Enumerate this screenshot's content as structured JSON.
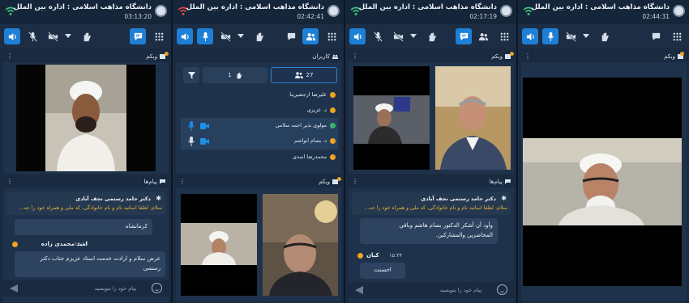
{
  "app": {
    "title": "دانشگاه مذاهب اسلامی : اداره بین الملل",
    "times": [
      "03:13:20",
      "02:42:41",
      "02:17:19",
      "02:44:31"
    ]
  },
  "colors": {
    "accent": "#1d7fd6",
    "orange": "#f0a321",
    "green": "#3ab36d",
    "pinned_text": "#f1b738"
  },
  "panels": {
    "webcam": "وبکم",
    "messages": "پیام‌ها",
    "users": "کاربران"
  },
  "users_panel": {
    "count_all": "27",
    "count_raised": "1",
    "list": [
      {
        "name": "علیرضا ارجشیرینا",
        "status": "orange"
      },
      {
        "name": "د. عزیزی",
        "status": "orange"
      },
      {
        "name": "مولوی نذیر احمد سلامی",
        "status": "green"
      },
      {
        "name": "د. بسام انواشم",
        "status": "orange"
      },
      {
        "name": "محمدرضا اسدی",
        "status": "orange"
      }
    ]
  },
  "chat1": {
    "pinned_name": "دکتر حامد رستمی نجف آبادی",
    "pinned_text": "سلام: لطفا اساتید نام و نام خانوادگی، کد ملی و همراه خود را جه...",
    "msg1": "کرمانشاه",
    "sender": "امید محمدی زاده",
    "time": "۱۶:۱۶",
    "msg2_line1": "عرض سلام و ارادت خدمت استاد عزیزم جناب دکتر",
    "msg2_line2": "رستمی",
    "placeholder": "پیام خود را بنویسید"
  },
  "chat2": {
    "pinned_name": "دکتر حامد رستمی نجف آبادی",
    "pinned_text": "سلام: لطفا اساتید نام و نام خانوادگی، کد ملی و همراه خود را جه...",
    "msg1_line1": "وأود أن أشكر الدكتور بسام هاشم وباقي",
    "msg1_line2": "المحاضرين والمشاركين.",
    "sender": "کیان",
    "time": "۱۵:۲۴",
    "msg2": "احسنت",
    "placeholder": "پیام خود را بنویسید"
  }
}
